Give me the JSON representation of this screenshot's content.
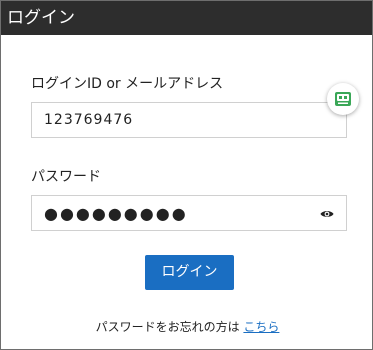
{
  "dialog": {
    "title": "ログイン"
  },
  "login_id": {
    "label": "ログインID or メールアドレス",
    "value": "123769476"
  },
  "password": {
    "label": "パスワード",
    "value": "●●●●●●●●●",
    "toggle_icon": "eye-icon"
  },
  "password_manager": {
    "icon": "password-manager-icon"
  },
  "submit": {
    "label": "ログイン"
  },
  "forgot": {
    "text": "パスワードをお忘れの方は ",
    "link_label": "こちら"
  },
  "colors": {
    "titlebar": "#2d2d2d",
    "accent": "#1a6ec2",
    "badge": "#3aa757"
  }
}
